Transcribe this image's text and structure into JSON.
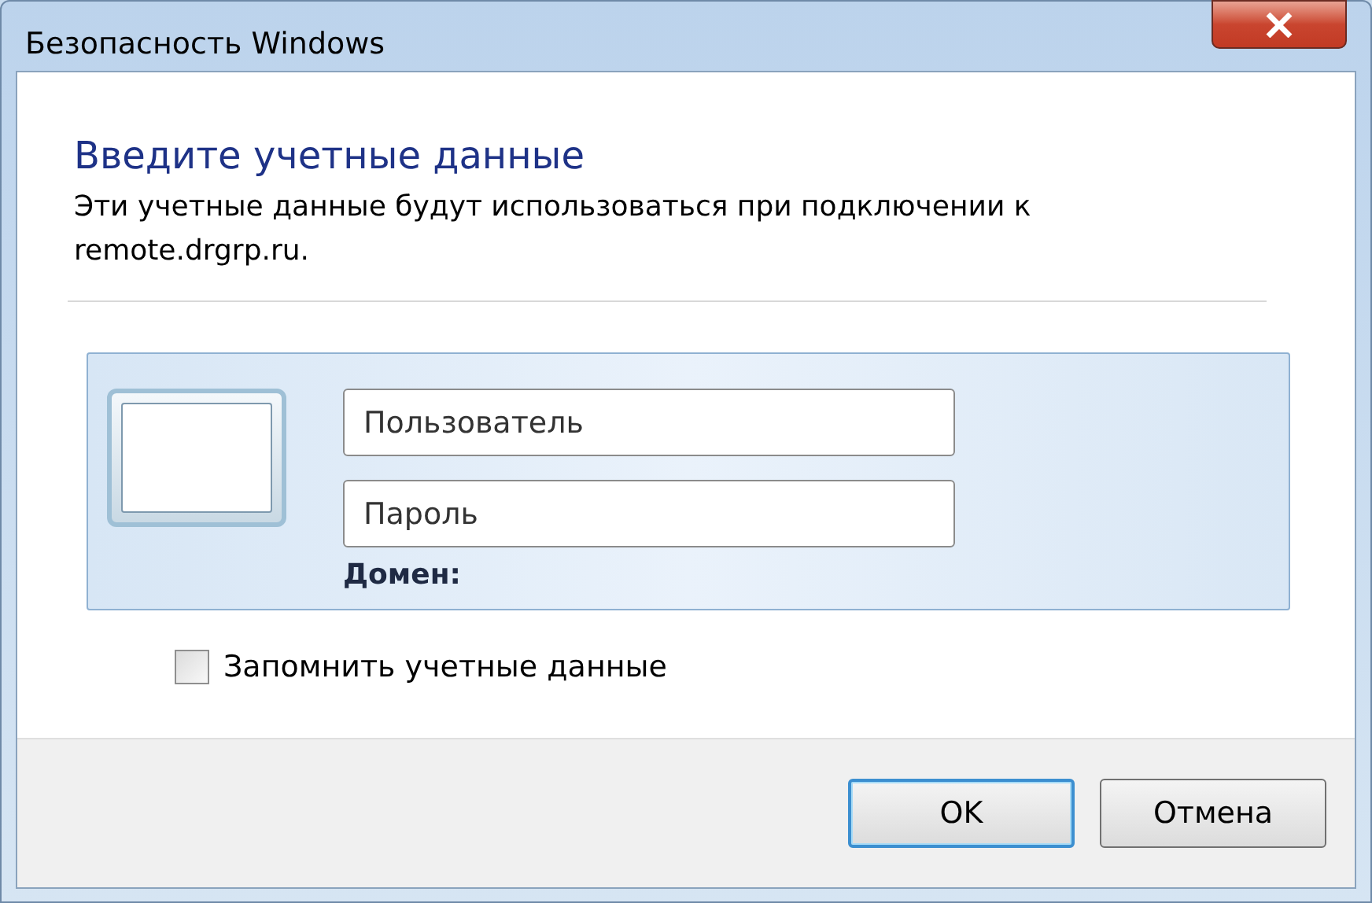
{
  "window": {
    "title": "Безопасность Windows"
  },
  "heading": "Введите учетные данные",
  "description": "Эти учетные данные будут использоваться при подключении к remote.drgrp.ru.",
  "fields": [
    {
      "placeholder": "Пользователь"
    },
    {
      "placeholder": "Пароль"
    }
  ],
  "domain_label": "Домен:",
  "remember": {
    "label": "Запомнить учетные данные",
    "checked": false
  },
  "buttons": [
    {
      "label": "OK",
      "default": true
    },
    {
      "label": "Отмена",
      "default": false
    }
  ]
}
